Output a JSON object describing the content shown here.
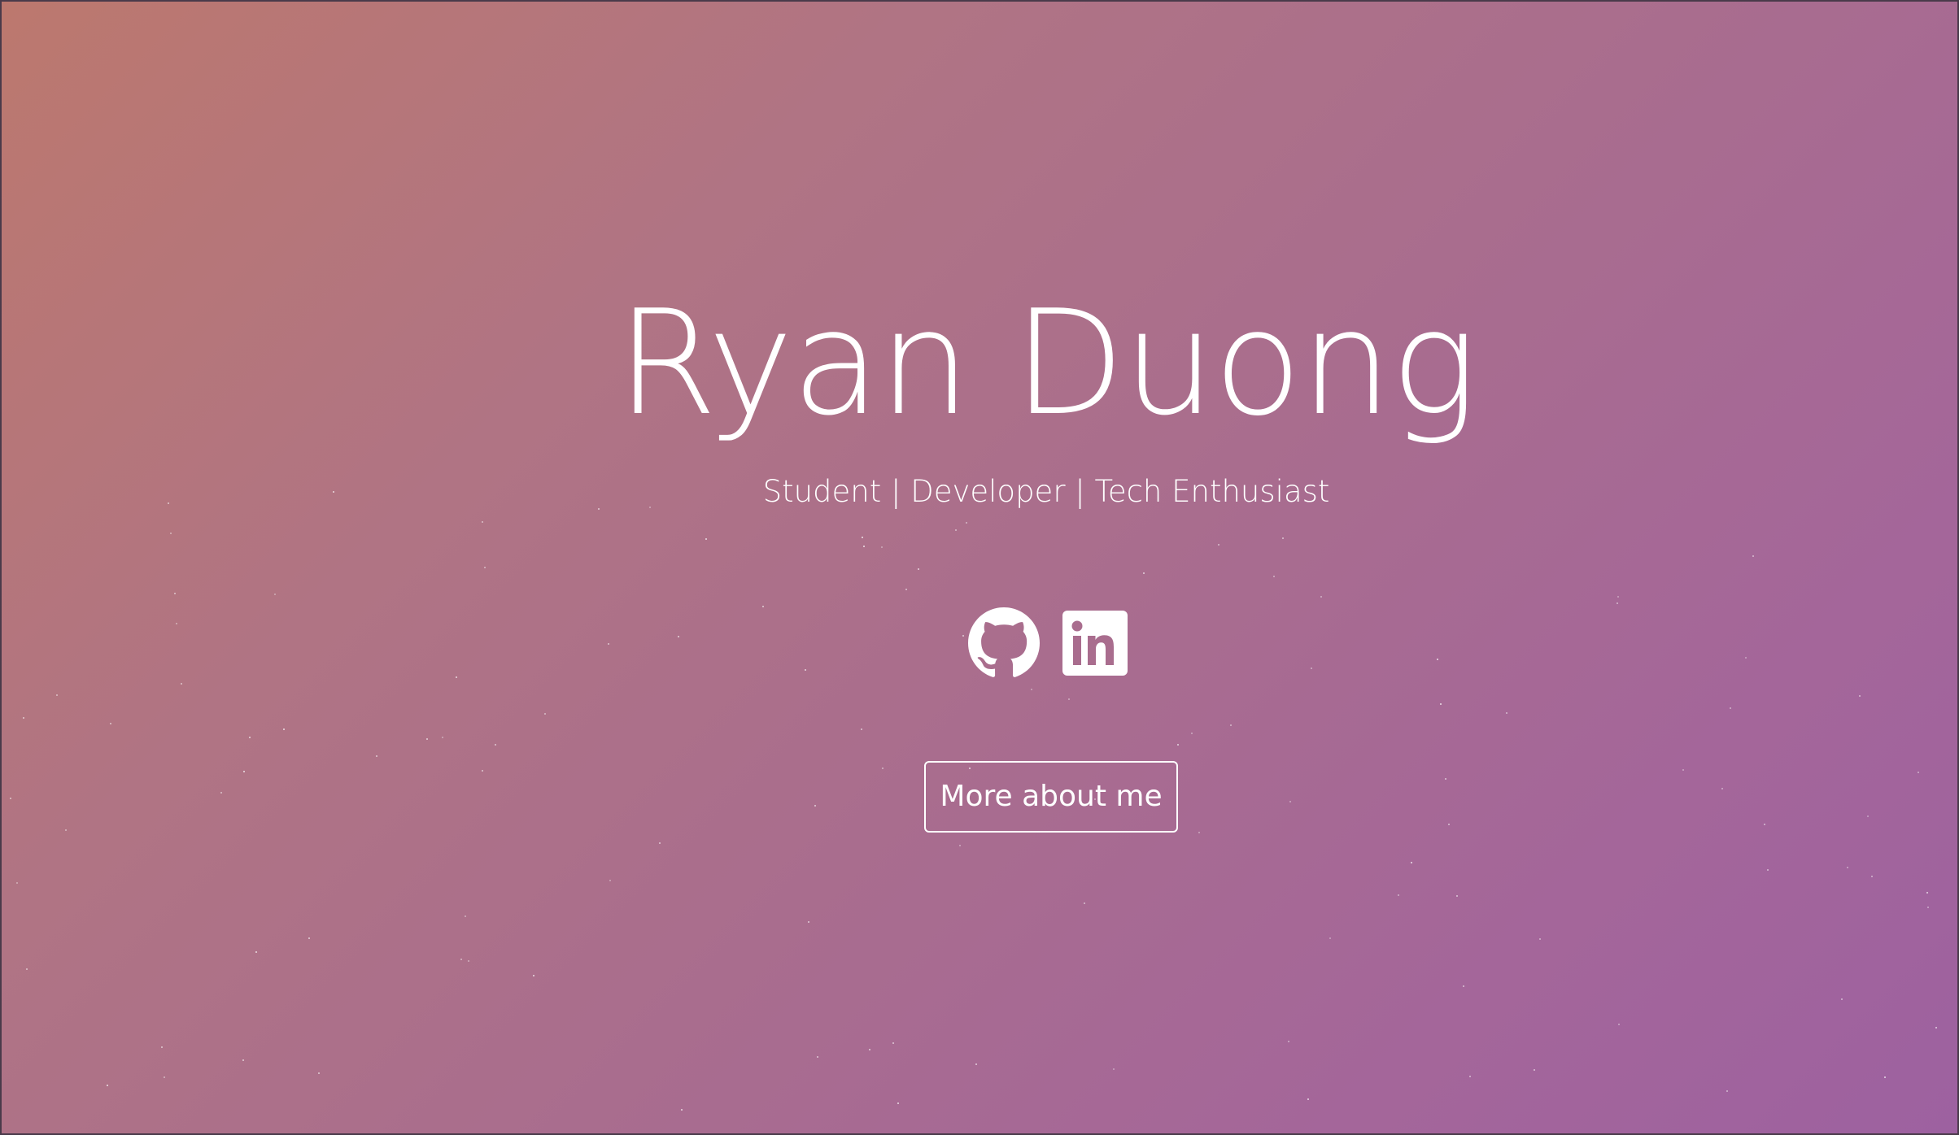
{
  "hero": {
    "name": "Ryan Duong",
    "tagline": "Student | Developer | Tech Enthusiast",
    "more_button_label": "More about me"
  },
  "socials": [
    {
      "icon": "github-icon",
      "name": "GitHub"
    },
    {
      "icon": "linkedin-icon",
      "name": "LinkedIn"
    }
  ],
  "colors": {
    "gradient_start": "#bc786e",
    "gradient_end": "#9d61a0",
    "text": "#ffffff"
  }
}
